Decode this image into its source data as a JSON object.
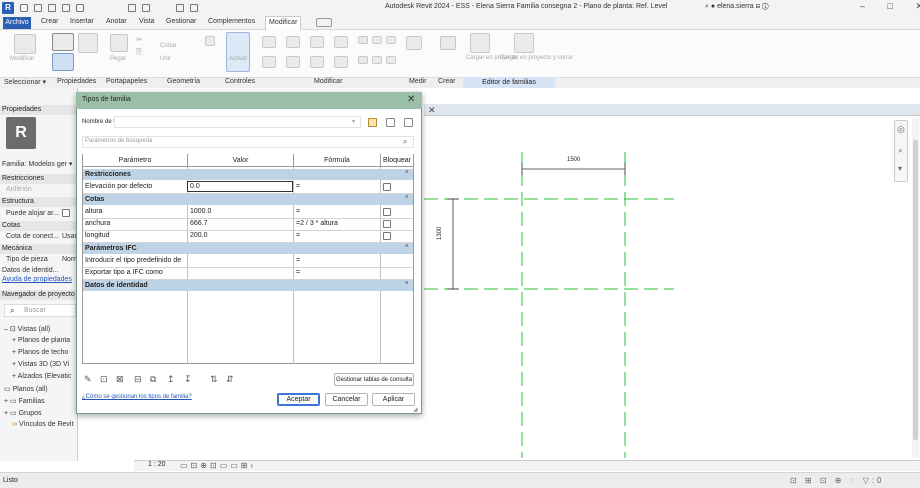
{
  "window": {
    "logo": "R",
    "title": "Autodesk Revit 2024 - ESS - Elena Sierra Familia consegna 2 - Plano de planta: Ref. Level",
    "user": "elena.sierra",
    "window_buttons": "–  □  ✕"
  },
  "menu": [
    "Archivo",
    "Crear",
    "Insertar",
    "Anotar",
    "Vista",
    "Gestionar",
    "Complementos",
    "Modificar"
  ],
  "ribbon": {
    "labels": {
      "modificar": "Modificar",
      "cortar": "Cortar",
      "unir": "Unir",
      "pegar": "Pegar",
      "activar": "Activar",
      "cargar_proyecto": "Cargar en proyecto",
      "cargar_cerrar": "Cargar en proyecto y cerrar"
    },
    "footer": {
      "seleccionar": "Seleccionar",
      "propiedades": "Propiedades",
      "portapapeles": "Portapapeles",
      "geometria": "Geometría",
      "controles": "Controles",
      "modificar": "Modificar",
      "medir": "Medir",
      "crear": "Crear",
      "editor": "Editor de familias"
    }
  },
  "left_panel": {
    "propiedades": "Propiedades",
    "familia": "Familia: Modelos ger",
    "restricciones": "Restricciones",
    "anfitrion": "Anfitrión",
    "estructura": "Estructura",
    "puede_alojar": "Puede alojar ar...",
    "cotas": "Cotas",
    "cota_conect": "Cota de conect...",
    "cota_conect_val": "Usar",
    "mecanica": "Mecánica",
    "tipo_pieza": "Tipo de pieza",
    "tipo_pieza_val": "Norm",
    "datos_ident": "Datos de identid...",
    "ayuda": "Ayuda de propiedades",
    "navegador": "Navegador de proyecto",
    "buscar": "Buscar",
    "tree": {
      "vistas": "Vistas (all)",
      "planos_planta": "Planos de planta",
      "planos_techo": "Planos de techo",
      "vistas3d": "Vistas 3D (3D Vi",
      "alzados": "Alzados (Elevatic",
      "planos_all": "Planos (all)",
      "familias": "Familias",
      "grupos": "Grupos",
      "vinculos": "Vínculos de Revit"
    }
  },
  "dialog": {
    "title": "Tipos de familia",
    "nombre_tipo_label": "Nombre de tipo:",
    "nombre_tipo_value": "",
    "search_placeholder": "Parámetros de búsqueda",
    "columns": [
      "Parámetro",
      "Valor",
      "Fórmula",
      "Bloquear"
    ],
    "groups": {
      "restricciones": "Restricciones",
      "cotas": "Cotas",
      "ifc": "Parámetros IFC",
      "identidad": "Datos de identidad"
    },
    "rows": {
      "elevacion": {
        "param": "Elevación por defecto",
        "value": "0.0",
        "formula": "="
      },
      "altura": {
        "param": "altura",
        "value": "1000.0",
        "formula": "="
      },
      "anchura": {
        "param": "anchura",
        "value": "666.7",
        "formula": "=2 / 3 * altura"
      },
      "longitud": {
        "param": "longitud",
        "value": "200.0",
        "formula": "="
      },
      "introducir": {
        "param": "Introducir el tipo predefinido de",
        "value": "",
        "formula": "="
      },
      "exportar": {
        "param": "Exportar tipo a IFC como",
        "value": "",
        "formula": "="
      }
    },
    "gestionar_button": "Gestionar tablas de consulta",
    "help_link": "¿Cómo se gestionan los tipos de familia?",
    "aceptar": "Aceptar",
    "cancelar": "Cancelar",
    "aplicar": "Aplicar"
  },
  "canvas": {
    "dim_1500": "1500",
    "dim_1300": "1300",
    "view_close": "✕"
  },
  "viewbar": {
    "scale": "1 : 20"
  },
  "status": {
    "text": "Listo"
  },
  "colors": {
    "accent": "#2b5fb4",
    "dialog_title": "#9bbfa6",
    "group_row": "#bfd3e6",
    "ref_plane": "#2bbf3a"
  }
}
